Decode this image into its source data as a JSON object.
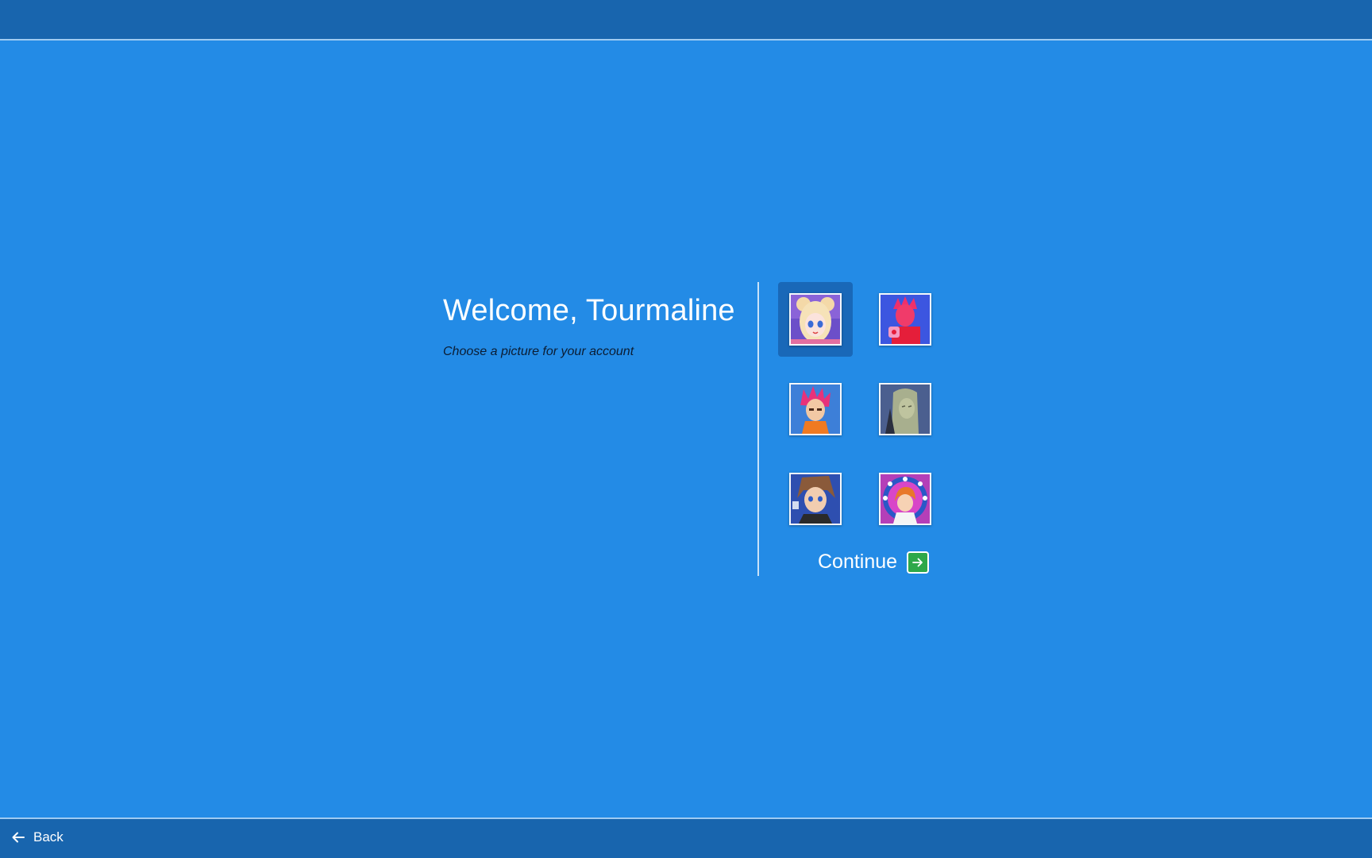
{
  "header": {},
  "welcome": {
    "title": "Welcome, Tourmaline",
    "subtitle": "Choose a picture for your account"
  },
  "avatars": {
    "selected_index": 0,
    "items": [
      {
        "icon": "avatar-pink-haired-girl-icon",
        "selected": true
      },
      {
        "icon": "avatar-red-haired-boy-icon",
        "selected": false
      },
      {
        "icon": "avatar-spiky-pink-hair-boy-icon",
        "selected": false
      },
      {
        "icon": "avatar-silver-haired-man-icon",
        "selected": false
      },
      {
        "icon": "avatar-brown-haired-boy-icon",
        "selected": false
      },
      {
        "icon": "avatar-orange-haired-girl-stars-icon",
        "selected": false
      }
    ]
  },
  "actions": {
    "continue_label": "Continue",
    "continue_icon": "arrow-right-icon",
    "back_label": "Back",
    "back_icon": "arrow-left-icon"
  },
  "colors": {
    "background": "#238BE6",
    "bars": "#1865AE",
    "selected_tile": "#1968B8",
    "continue_accent": "#2EA84A"
  }
}
